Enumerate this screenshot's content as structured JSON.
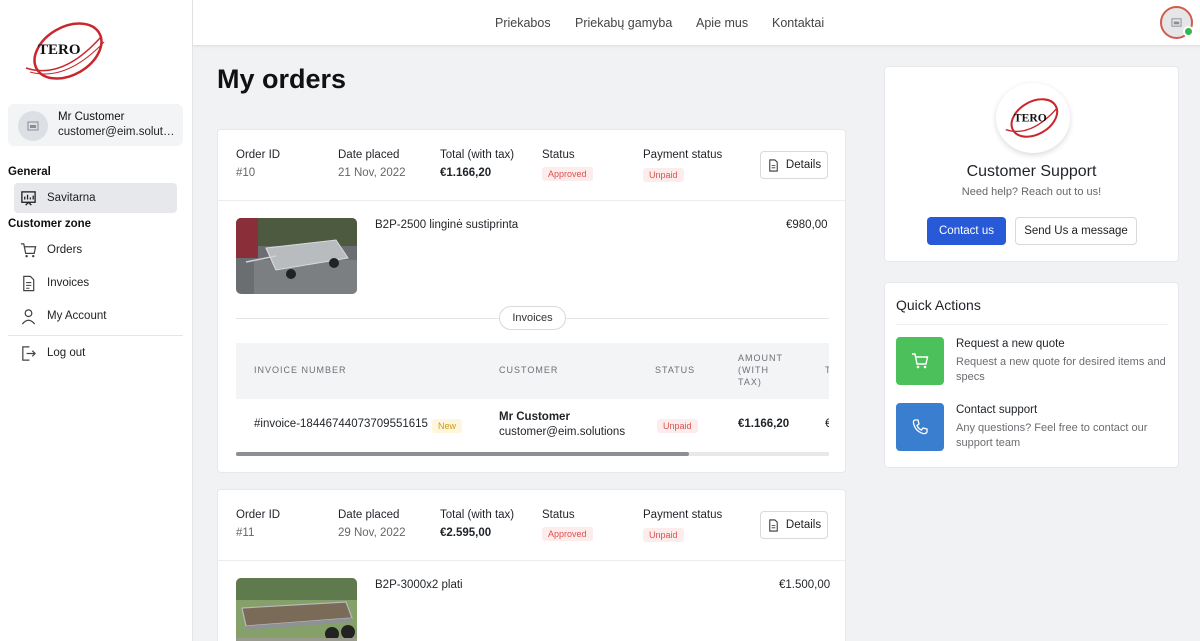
{
  "brand": {
    "logo_text": "TERO",
    "accent_color": "#c8282d"
  },
  "nav": {
    "links": [
      "Priekabos",
      "Priekabų gamyba",
      "Apie mus",
      "Kontaktai"
    ]
  },
  "user": {
    "name": "Mr Customer",
    "email": "customer@eim.solutions"
  },
  "sidebar": {
    "section_general": "General",
    "section_customer": "Customer zone",
    "items": [
      {
        "label": "Savitarna",
        "icon": "dashboard-icon",
        "active": true
      },
      {
        "label": "Orders",
        "icon": "cart-icon"
      },
      {
        "label": "Invoices",
        "icon": "document-icon"
      },
      {
        "label": "My Account",
        "icon": "user-icon"
      },
      {
        "label": "Log out",
        "icon": "logout-icon"
      }
    ]
  },
  "page": {
    "title": "My orders"
  },
  "orders": [
    {
      "labels": {
        "id": "Order ID",
        "date": "Date placed",
        "total": "Total (with tax)",
        "status": "Status",
        "payment": "Payment status"
      },
      "id": "#10",
      "date": "21 Nov, 2022",
      "total": "€1.166,20",
      "status": "Approved",
      "payment_status": "Unpaid",
      "details_label": "Details",
      "product": {
        "name": "B2P-2500 linginė sustiprinta",
        "price": "€980,00"
      },
      "invoices_label": "Invoices",
      "invoice_table": {
        "headers": [
          "INVOICE NUMBER",
          "CUSTOMER",
          "STATUS",
          "AMOUNT",
          "(WITH",
          "TAX)",
          "T"
        ],
        "row": {
          "number": "#invoice-18446744073709551615",
          "tag": "New",
          "customer_name": "Mr Customer",
          "customer_email": "customer@eim.solutions",
          "status": "Unpaid",
          "amount": "€1.166,20",
          "cut": "€"
        }
      }
    },
    {
      "labels": {
        "id": "Order ID",
        "date": "Date placed",
        "total": "Total (with tax)",
        "status": "Status",
        "payment": "Payment status"
      },
      "id": "#11",
      "date": "29 Nov, 2022",
      "total": "€2.595,00",
      "status": "Approved",
      "payment_status": "Unpaid",
      "details_label": "Details",
      "product": {
        "name": "B2P-3000x2 plati",
        "price": "€1.500,00"
      }
    }
  ],
  "support": {
    "title": "Customer Support",
    "subtitle": "Need help? Reach out to us!",
    "contact_label": "Contact us",
    "message_label": "Send Us a message"
  },
  "quick_actions": {
    "title": "Quick Actions",
    "items": [
      {
        "title": "Request a new quote",
        "desc": "Request a new quote for desired items and specs",
        "icon": "cart-icon",
        "color": "#4cc05a"
      },
      {
        "title": "Contact support",
        "desc": "Any questions? Feel free to contact our support team",
        "icon": "phone-icon",
        "color": "#3a7ed0"
      }
    ]
  }
}
